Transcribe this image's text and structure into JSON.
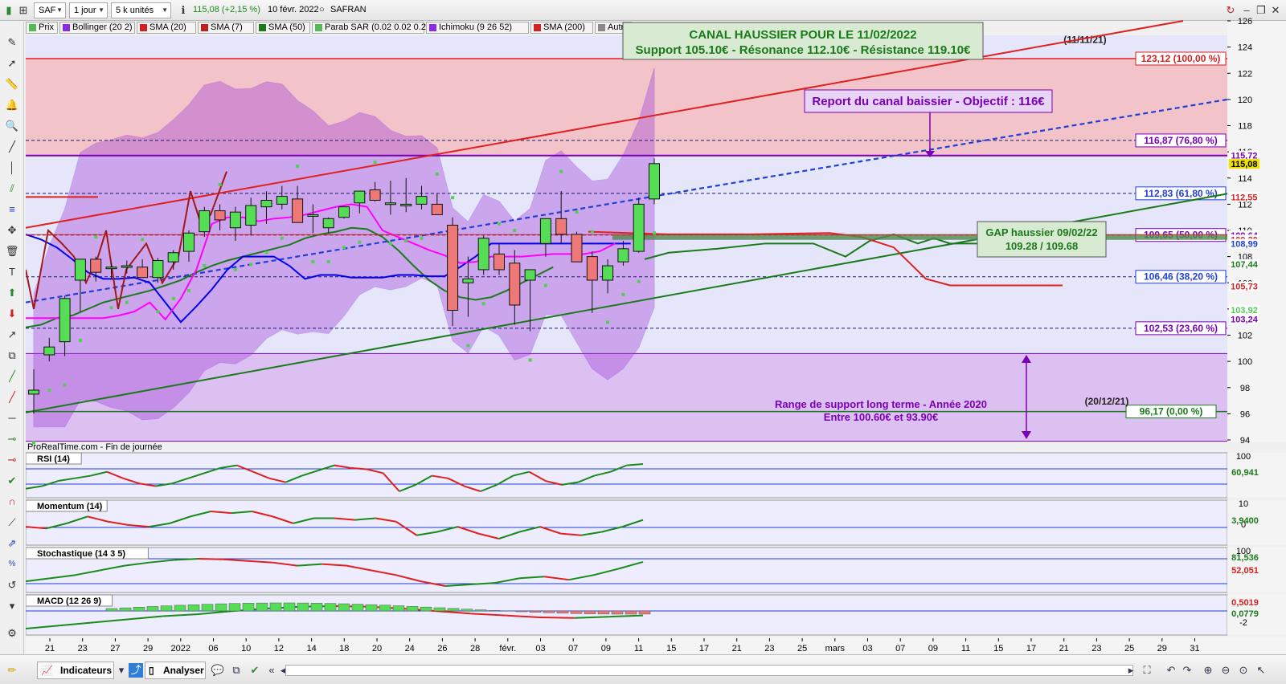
{
  "toolbar": {
    "symbol": "SAF",
    "period": "1 jour",
    "units": "5 k unités",
    "last_change": "115,08 (+2,15 %)",
    "date": "10 févr. 2022",
    "name": "SAFRAN"
  },
  "indicators_bar": [
    "Prix",
    "Bollinger (20 2)",
    "SMA (20)",
    "SMA (7)",
    "SMA (50)",
    "Parab SAR (0.02 0.02 0.2)",
    "Ichimoku (9 26 52)",
    "SMA (200)",
    "Autres"
  ],
  "indicator_colors": [
    "#55b955",
    "#8a2be2",
    "#d42020",
    "#c02020",
    "#1a7a1a",
    "#55b955",
    "#8a2be2",
    "#d42020",
    "#888888"
  ],
  "source_label": "ProRealTime.com - Fin de journée",
  "bottom": {
    "indicators_button": "Indicateurs",
    "analyze_button": "Analyser"
  },
  "colors": {
    "up": "#55dd55",
    "down": "#ee7777",
    "bollinger": "#8a2be2",
    "channel_red": "#e02020",
    "channel_green": "#1a8a1a",
    "projection": "#1f3fd8",
    "kijun": "#0000ee",
    "tenkan": "#ff00ff",
    "fib_line": "#7a00b5"
  },
  "chart_data": {
    "type": "candlestick",
    "title": "",
    "y_axis": {
      "min": 93,
      "max": 126,
      "ticks": [
        94,
        96,
        98,
        100,
        102,
        104,
        106,
        108,
        110,
        112,
        114,
        116,
        118,
        120,
        122,
        124,
        126
      ]
    },
    "x_axis": {
      "labels": [
        "21",
        "23",
        "27",
        "29",
        "2022",
        "06",
        "10",
        "12",
        "14",
        "18",
        "20",
        "24",
        "26",
        "28",
        "févr.",
        "03",
        "07",
        "09",
        "11",
        "15",
        "17",
        "21",
        "23",
        "25",
        "mars",
        "03",
        "07",
        "09",
        "11",
        "15",
        "17",
        "21",
        "23",
        "25",
        "29",
        "31"
      ]
    },
    "candles": [
      {
        "o": 97.5,
        "h": 99.4,
        "l": 96.0,
        "c": 97.8
      },
      {
        "o": 100.5,
        "h": 101.8,
        "l": 100.0,
        "c": 101.1
      },
      {
        "o": 101.5,
        "h": 105.0,
        "l": 100.4,
        "c": 104.8
      },
      {
        "o": 106.2,
        "h": 107.0,
        "l": 103.8,
        "c": 107.8
      },
      {
        "o": 107.8,
        "h": 108.0,
        "l": 106.1,
        "c": 106.8
      },
      {
        "o": 107.2,
        "h": 107.5,
        "l": 106.3,
        "c": 107.2
      },
      {
        "o": 107.2,
        "h": 107.7,
        "l": 106.7,
        "c": 107.3
      },
      {
        "o": 107.2,
        "h": 107.8,
        "l": 106.4,
        "c": 106.4
      },
      {
        "o": 106.4,
        "h": 107.9,
        "l": 106.0,
        "c": 107.7
      },
      {
        "o": 107.6,
        "h": 108.5,
        "l": 107.0,
        "c": 108.3
      },
      {
        "o": 108.4,
        "h": 110.0,
        "l": 107.6,
        "c": 109.8
      },
      {
        "o": 109.9,
        "h": 111.8,
        "l": 109.5,
        "c": 111.5
      },
      {
        "o": 111.5,
        "h": 112.0,
        "l": 110.0,
        "c": 110.8
      },
      {
        "o": 110.2,
        "h": 111.8,
        "l": 109.2,
        "c": 111.4
      },
      {
        "o": 110.4,
        "h": 112.5,
        "l": 109.6,
        "c": 111.9
      },
      {
        "o": 111.8,
        "h": 113.0,
        "l": 110.5,
        "c": 112.3
      },
      {
        "o": 112.0,
        "h": 113.4,
        "l": 111.6,
        "c": 112.6
      },
      {
        "o": 112.4,
        "h": 113.4,
        "l": 110.7,
        "c": 110.6
      },
      {
        "o": 111.2,
        "h": 112.0,
        "l": 109.8,
        "c": 111.2
      },
      {
        "o": 110.2,
        "h": 111.0,
        "l": 109.8,
        "c": 110.9
      },
      {
        "o": 111.0,
        "h": 111.8,
        "l": 110.9,
        "c": 111.8
      },
      {
        "o": 112.1,
        "h": 112.7,
        "l": 111.3,
        "c": 113.0
      },
      {
        "o": 113.1,
        "h": 113.7,
        "l": 112.2,
        "c": 112.3
      },
      {
        "o": 112.0,
        "h": 113.8,
        "l": 111.2,
        "c": 112.1
      },
      {
        "o": 111.9,
        "h": 114.0,
        "l": 111.4,
        "c": 112.0
      },
      {
        "o": 112.0,
        "h": 113.4,
        "l": 111.6,
        "c": 112.6
      },
      {
        "o": 112.0,
        "h": 112.8,
        "l": 111.2,
        "c": 111.2
      },
      {
        "o": 110.4,
        "h": 111.0,
        "l": 102.7,
        "c": 103.9
      },
      {
        "o": 106.0,
        "h": 108.0,
        "l": 103.4,
        "c": 106.3
      },
      {
        "o": 107.0,
        "h": 109.6,
        "l": 106.6,
        "c": 109.4
      },
      {
        "o": 108.2,
        "h": 109.0,
        "l": 106.6,
        "c": 107.0
      },
      {
        "o": 107.5,
        "h": 108.5,
        "l": 102.8,
        "c": 104.3
      },
      {
        "o": 106.2,
        "h": 106.9,
        "l": 102.3,
        "c": 107.0
      },
      {
        "o": 109.0,
        "h": 110.1,
        "l": 108.0,
        "c": 110.9
      },
      {
        "o": 110.9,
        "h": 113.0,
        "l": 109.0,
        "c": 109.7
      },
      {
        "o": 109.7,
        "h": 109.9,
        "l": 107.8,
        "c": 107.6
      },
      {
        "o": 108.0,
        "h": 108.4,
        "l": 103.7,
        "c": 106.2
      },
      {
        "o": 106.2,
        "h": 107.8,
        "l": 105.2,
        "c": 107.3
      },
      {
        "o": 107.6,
        "h": 109.2,
        "l": 107.3,
        "c": 108.6
      },
      {
        "o": 108.4,
        "h": 112.5,
        "l": 108.3,
        "c": 112.0
      },
      {
        "o": 112.4,
        "h": 115.5,
        "l": 112.0,
        "c": 115.1
      }
    ],
    "fib_levels": [
      {
        "value": 123.12,
        "label": "123,12 (100,00 %)"
      },
      {
        "value": 116.87,
        "label": "116,87 (76,80 %)"
      },
      {
        "value": 112.83,
        "label": "112,83 (61,80 %)"
      },
      {
        "value": 109.65,
        "label": "109,65 (50,00 %)"
      },
      {
        "value": 106.46,
        "label": "106,46 (38,20 %)"
      },
      {
        "value": 102.53,
        "label": "102,53 (23,60 %)"
      },
      {
        "value": 96.17,
        "label": "96,17 (0,00 %)"
      }
    ],
    "fib_dates": [
      "(11/11/21)",
      "(20/12/21)"
    ],
    "price_tags": [
      {
        "value": 115.72,
        "label": "115,72"
      },
      {
        "value": 115.08,
        "label": "115,08"
      },
      {
        "value": 112.55,
        "label": "112,55"
      },
      {
        "value": 109.64,
        "label": "109,64"
      },
      {
        "value": 109.3,
        "label": "109,30"
      },
      {
        "value": 108.99,
        "label": "108,99"
      },
      {
        "value": 107.44,
        "label": "107,44"
      },
      {
        "value": 105.73,
        "label": "105,73"
      },
      {
        "value": 103.92,
        "label": "103,92"
      },
      {
        "value": 103.24,
        "label": "103,24"
      }
    ],
    "annotations": {
      "channel_title": "CANAL HAUSSIER POUR LE 11/02/2022",
      "channel_levels": "Support 105.10€ - Résonance 112.10€ - Résistance 119.10€",
      "report": "Report du canal baissier - Objectif : 116€",
      "gap_title": "GAP haussier 09/02/22",
      "gap_values": "109.28 / 109.68",
      "range_title": "Range de support long terme - Année 2020",
      "range_values": "Entre 100.60€ et 93.90€"
    },
    "subpanels": [
      {
        "name": "RSI (14)",
        "ticks": [
          "100"
        ],
        "value": "60,941",
        "values": [
          42,
          44,
          48,
          50,
          52,
          55,
          50,
          46,
          44,
          46,
          50,
          54,
          58,
          60,
          55,
          50,
          47,
          52,
          56,
          60,
          58,
          57,
          54,
          40,
          45,
          52,
          50,
          44,
          40,
          45,
          52,
          55,
          48,
          45,
          47,
          52,
          55,
          60,
          61
        ]
      },
      {
        "name": "Momentum (14)",
        "ticks": [
          "10",
          "0"
        ],
        "value": "3,9400",
        "values": [
          0,
          -1,
          2,
          6,
          3,
          1,
          0,
          2,
          6,
          9,
          8,
          9,
          6,
          2,
          5,
          5,
          4,
          5,
          3,
          -5,
          -3,
          0,
          -4,
          -7,
          -3,
          0,
          -4,
          -5,
          -3,
          0,
          4
        ]
      },
      {
        "name": "Stochastique (14 3 5)",
        "ticks": [
          "100"
        ],
        "value": "81,536",
        "signal_value": "52,051",
        "values": [
          20,
          30,
          40,
          55,
          70,
          80,
          88,
          92,
          90,
          85,
          80,
          70,
          75,
          70,
          55,
          40,
          20,
          5,
          10,
          15,
          30,
          35,
          25,
          40,
          60,
          82
        ]
      },
      {
        "name": "MACD (12 26 9)",
        "ticks": [
          "-2"
        ],
        "value": "0,0779",
        "signal_value": "0,5019",
        "values": [
          -2.0,
          -1.5,
          -1.0,
          -0.5,
          0.0,
          0.3,
          0.8,
          1.2,
          1.5,
          1.6,
          1.5,
          1.2,
          0.8,
          0.4,
          0.1,
          -0.2,
          -0.3,
          -0.1,
          0.1
        ]
      }
    ]
  }
}
